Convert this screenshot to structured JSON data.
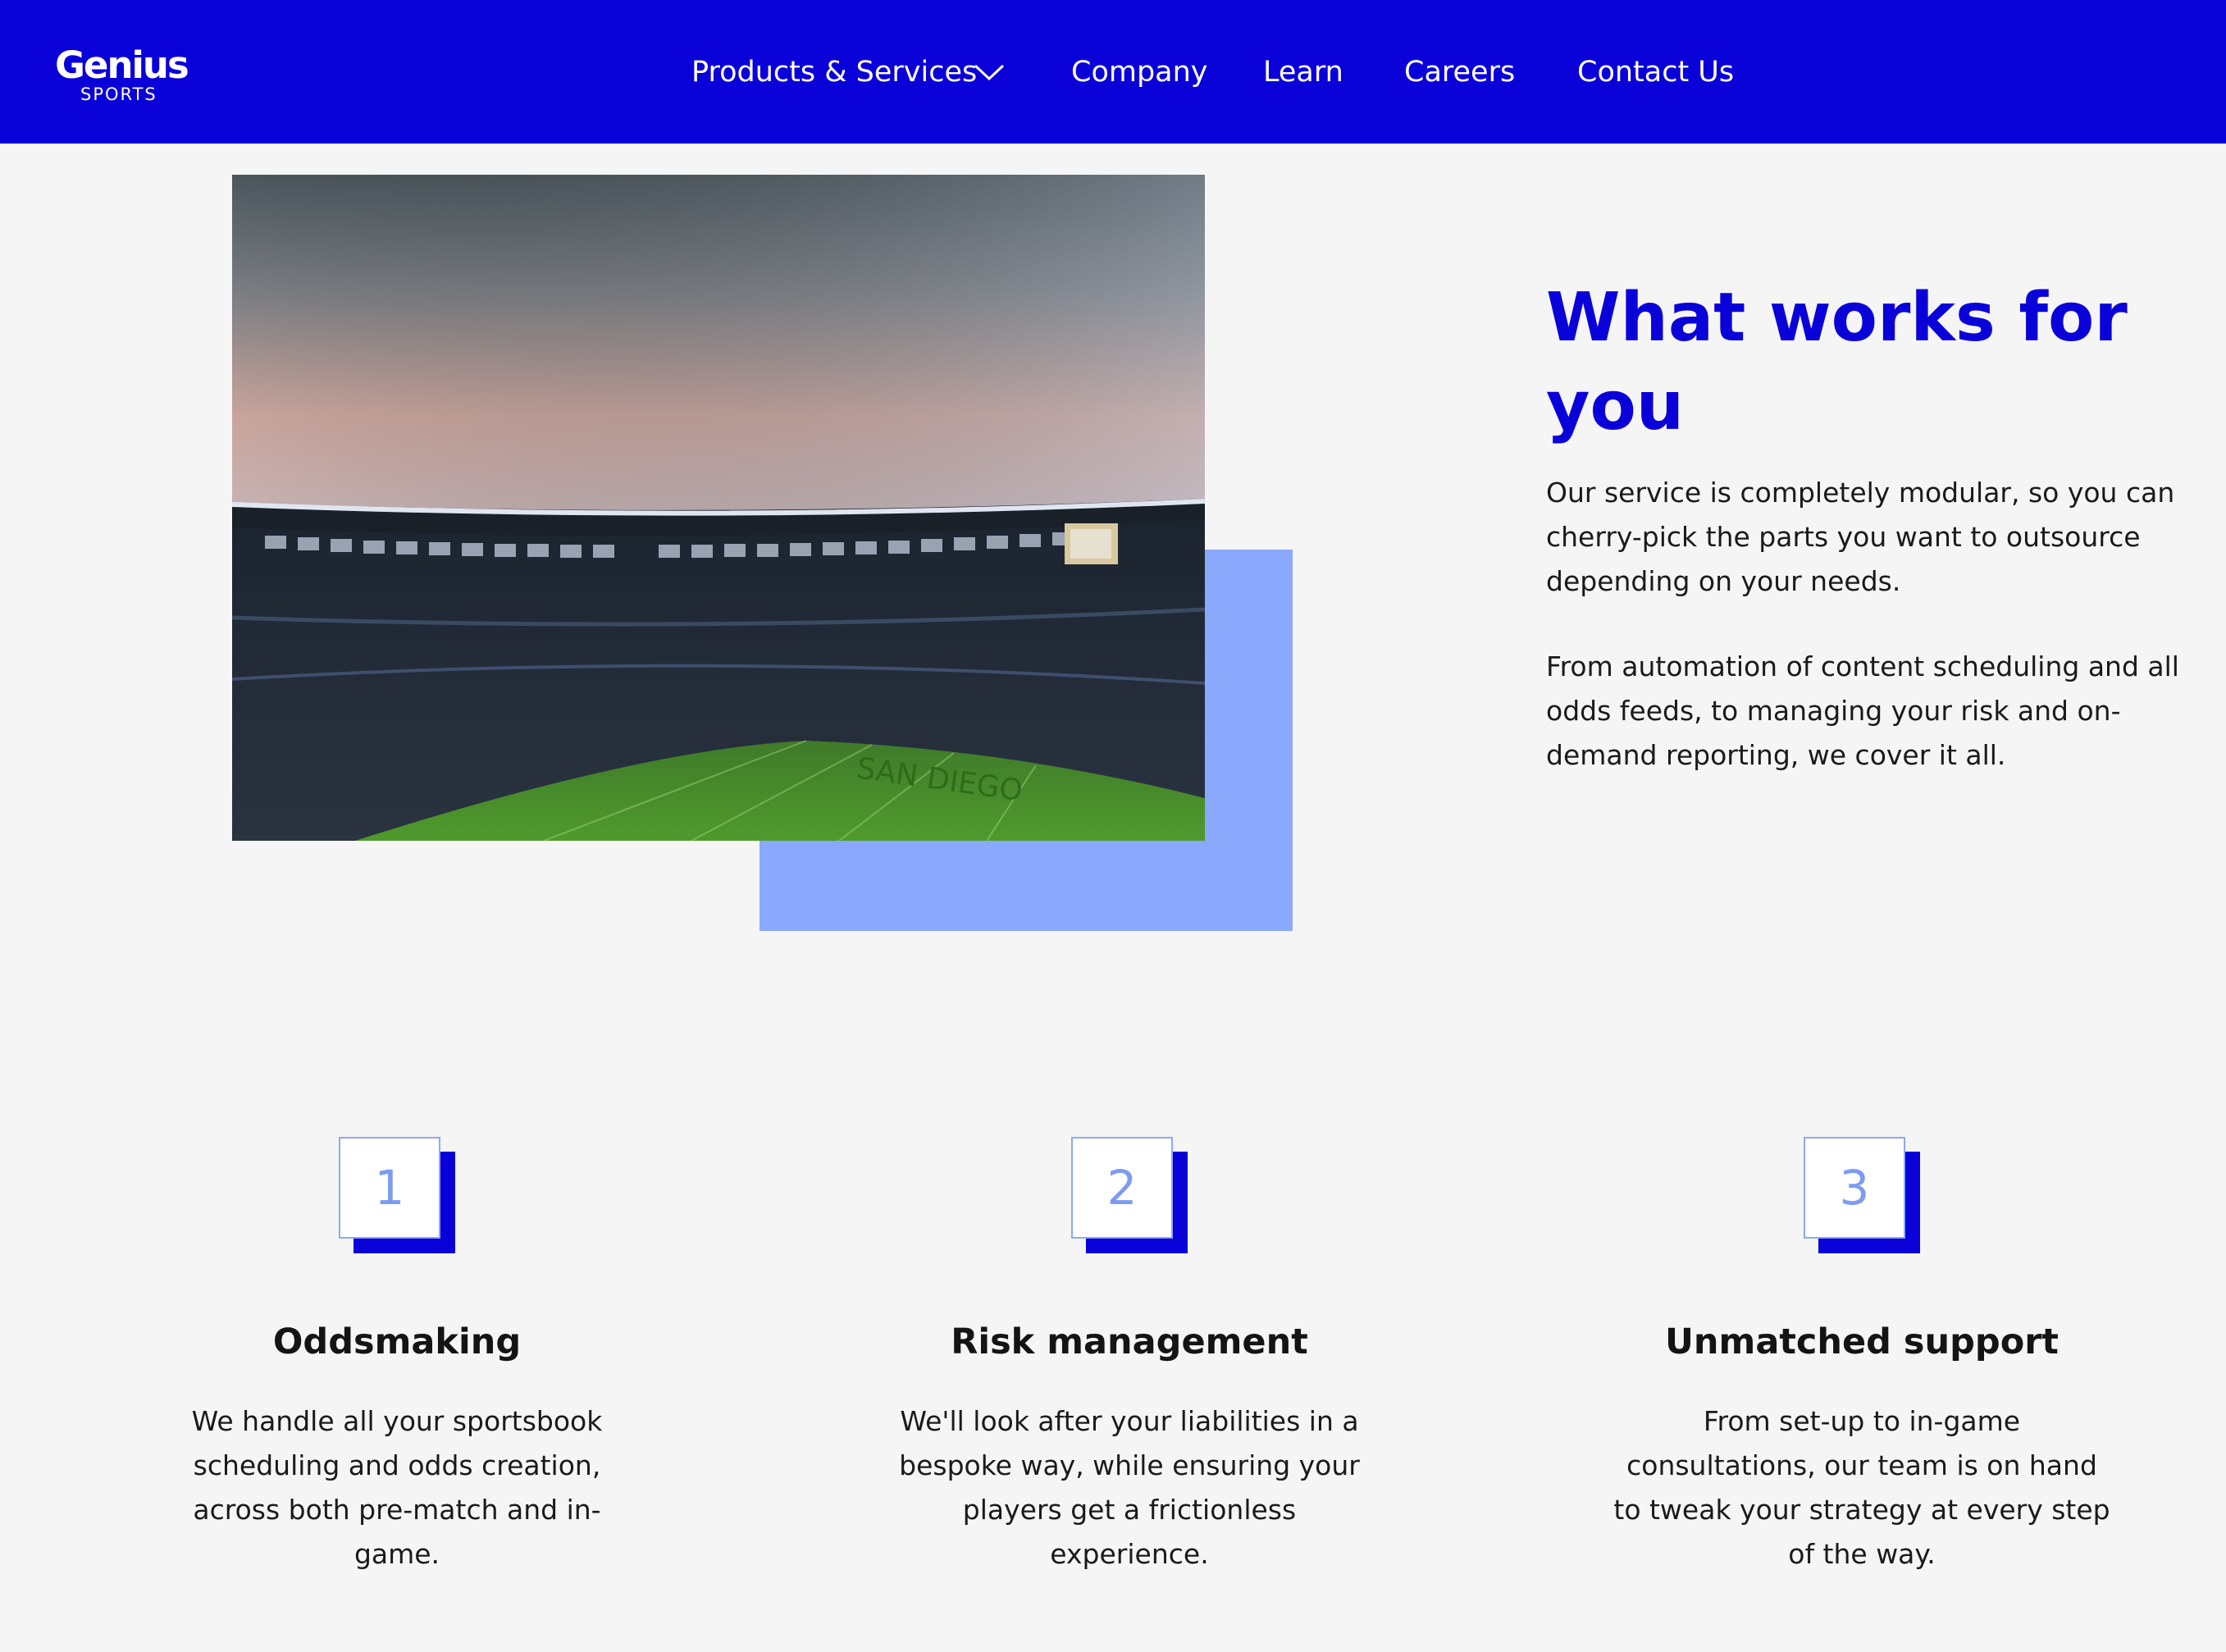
{
  "header": {
    "logo_main": "Genius",
    "logo_sub": "SPORTS",
    "nav": [
      {
        "label": "Products & Services"
      },
      {
        "label": "Company"
      },
      {
        "label": "Learn"
      },
      {
        "label": "Careers"
      },
      {
        "label": "Contact Us"
      }
    ]
  },
  "hero": {
    "heading": "What works for you",
    "paragraphs": [
      "Our service is completely modular, so you can cherry-pick the parts you want to outsource depending on your needs.",
      "From automation of content scheduling and all odds feeds, to managing your risk and on-demand reporting, we cover it all."
    ]
  },
  "features": [
    {
      "number": "1",
      "title": "Oddsmaking",
      "description": "We handle all your sportsbook scheduling and odds creation, across both pre-match and in-game."
    },
    {
      "number": "2",
      "title": "Risk management",
      "description": "We'll look after your liabilities in a bespoke way, while ensuring your players get a frictionless experience."
    },
    {
      "number": "3",
      "title": "Unmatched support",
      "description": "From set-up to in-game consultations, our team is on hand to tweak your strategy at every step of the way."
    }
  ],
  "colors": {
    "brand": "#0a00d8",
    "accent": "#8aa8fc",
    "background": "#f5f5f5"
  },
  "icons": {
    "dropdown": "chevron-down-icon"
  }
}
